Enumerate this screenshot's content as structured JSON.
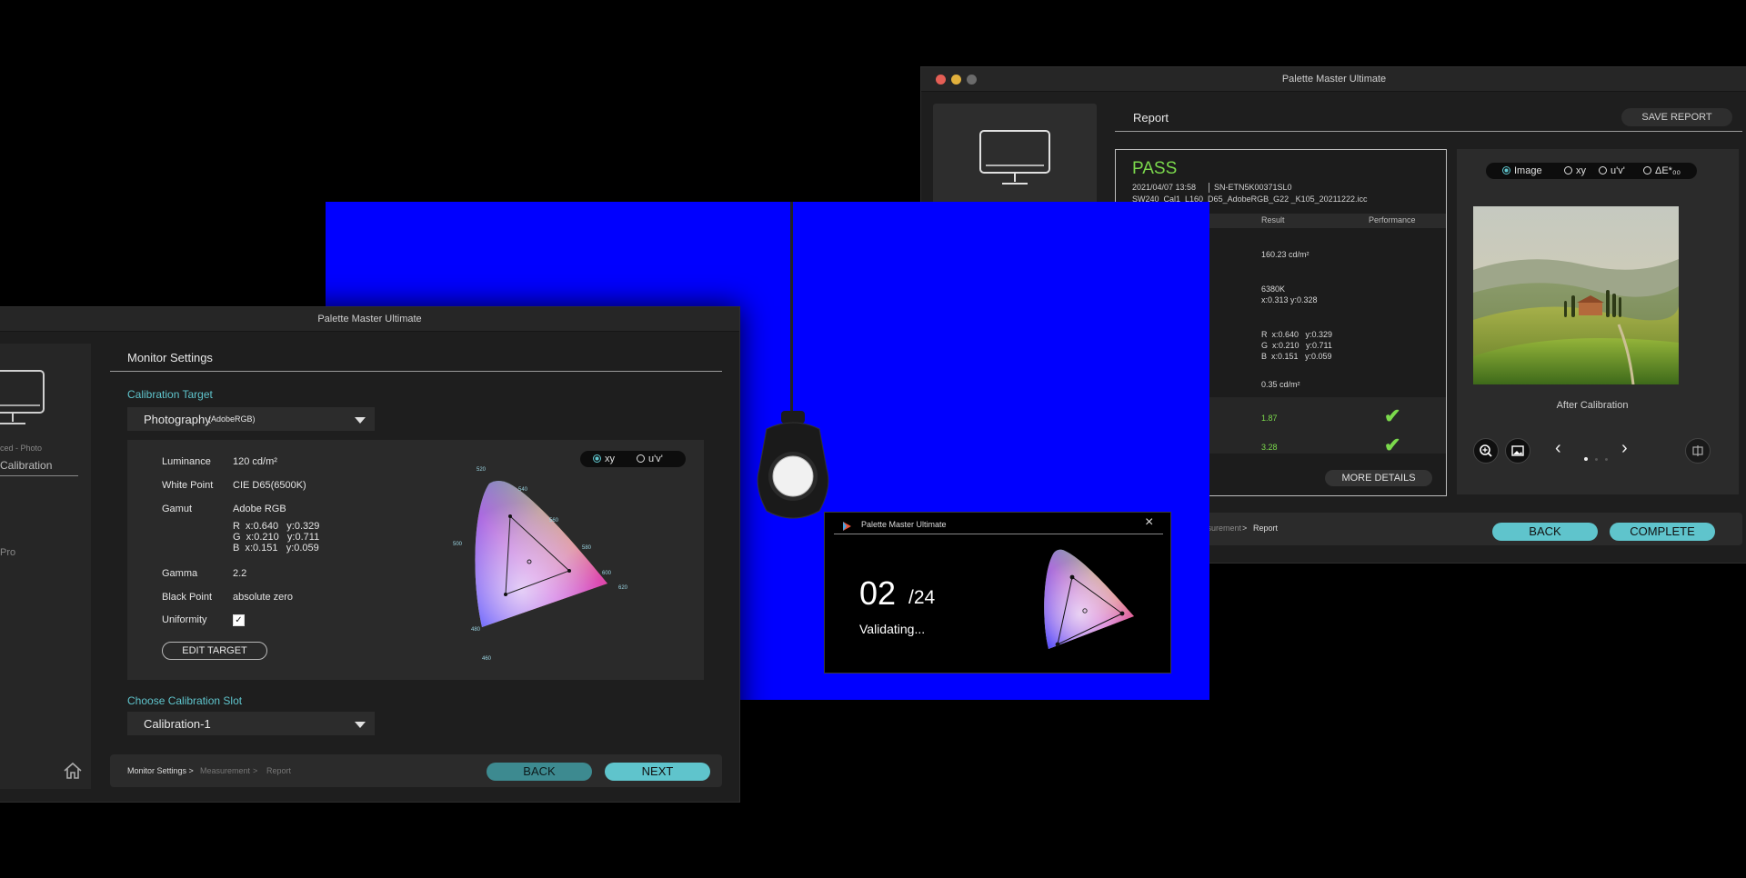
{
  "report_window": {
    "title": "Palette Master Ultimate",
    "section_title": "Report",
    "save_report_label": "SAVE REPORT",
    "status": "PASS",
    "datetime": "2021/04/07 13:58",
    "serial": "SN-ETN5K00371SL0",
    "profile": "SW240_Cal1_L160_D65_AdobeRGB_G22 _K105_20211222.icc",
    "columns": {
      "result": "Result",
      "performance": "Performance"
    },
    "results": {
      "luminance": "160.23 cd/m²",
      "white_temp": "6380K",
      "white_xy": "x:0.313  y:0.328",
      "gamut_r": "R  x:0.640   y:0.329",
      "gamut_g": "G  x:0.210   y:0.711",
      "gamut_b": "B  x:0.151   y:0.059",
      "black": "0.35 cd/m²",
      "delta_1": "1.87",
      "delta_2": "3.28"
    },
    "more_details_label": "MORE DETAILS",
    "view_options": [
      "Image",
      "xy",
      "u'v'",
      "ΔE*₀₀"
    ],
    "preview_caption": "After Calibration",
    "breadcrumb": {
      "measurement": "Measurement",
      "sep": ">",
      "report": "Report"
    },
    "back_label": "BACK",
    "complete_label": "COMPLETE"
  },
  "settings_window": {
    "title": "Palette Master Ultimate",
    "sidebar": {
      "mode": "ced - Photo",
      "calibration": "Calibration",
      "pro": "Pro"
    },
    "section_title": "Monitor Settings",
    "calibration_target_label": "Calibration Target",
    "target_value": "Photography",
    "target_sub": "(AdobeRGB)",
    "toggle_xy": "xy",
    "toggle_uv": "u'v'",
    "rows": {
      "luminance_label": "Luminance",
      "luminance_value": "120 cd/m²",
      "white_label": "White Point",
      "white_value": "CIE D65(6500K)",
      "gamut_label": "Gamut",
      "gamut_value": "Adobe RGB",
      "gamut_r": "R  x:0.640   y:0.329",
      "gamut_g": "G  x:0.210   y:0.711",
      "gamut_b": "B  x:0.151   y:0.059",
      "gamma_label": "Gamma",
      "gamma_value": "2.2",
      "black_label": "Black Point",
      "black_value": "absolute zero",
      "uniformity_label": "Uniformity"
    },
    "edit_target_label": "EDIT TARGET",
    "slot_label": "Choose Calibration Slot",
    "slot_value": "Calibration-1",
    "breadcrumb": {
      "step1": "Monitor Settings >",
      "step2": "Measurement",
      "sep": ">",
      "step3": "Report"
    },
    "back_label": "BACK",
    "next_label": "NEXT",
    "gamut_ticks": [
      "520",
      "540",
      "560",
      "580",
      "500",
      "600",
      "620",
      "480",
      "460"
    ]
  },
  "progress_dialog": {
    "title": "Palette Master Ultimate",
    "current": "02",
    "total": "/24",
    "status": "Validating..."
  },
  "colors": {
    "accent": "#5fc4cc",
    "pass": "#7bd94c",
    "screen_blue": "#0000ff"
  }
}
